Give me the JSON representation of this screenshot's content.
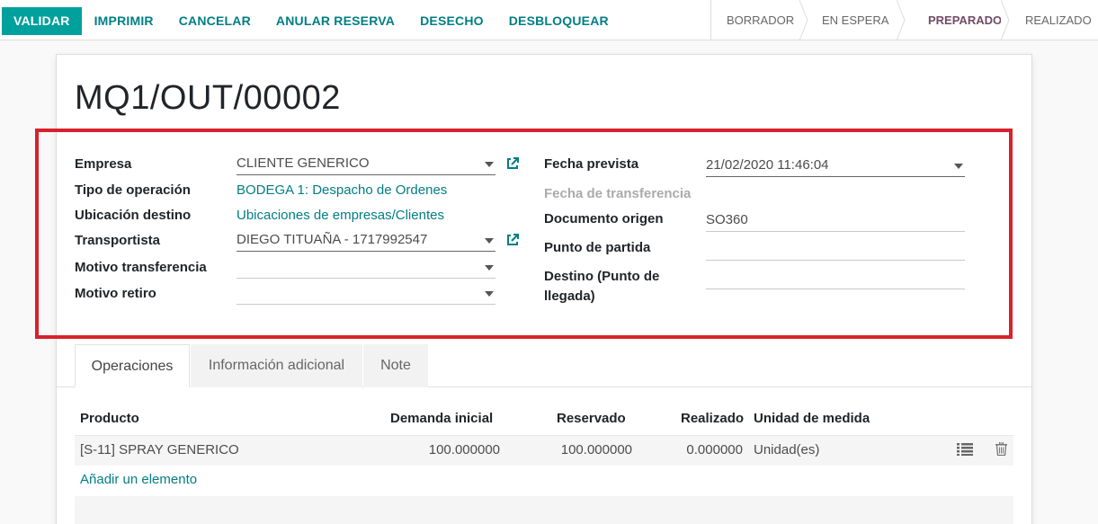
{
  "controlbar": {
    "actions": [
      "VALIDAR",
      "IMPRIMIR",
      "CANCELAR",
      "ANULAR RESERVA",
      "DESECHO",
      "DESBLOQUEAR"
    ],
    "stages": [
      "BORRADOR",
      "EN ESPERA",
      "PREPARADO",
      "REALIZADO"
    ],
    "active_stage": "PREPARADO"
  },
  "record": {
    "title": "MQ1/OUT/00002"
  },
  "left_fields": {
    "empresa": {
      "label": "Empresa",
      "value": "CLIENTE GENERICO"
    },
    "tipo_operacion": {
      "label": "Tipo de operación",
      "value": "BODEGA 1: Despacho de Ordenes"
    },
    "ubicacion_destino": {
      "label": "Ubicación destino",
      "value": "Ubicaciones de empresas/Clientes"
    },
    "transportista": {
      "label": "Transportista",
      "value": "DIEGO TITUAÑA - 1717992547"
    },
    "motivo_transferencia": {
      "label": "Motivo transferencia",
      "value": ""
    },
    "motivo_retiro": {
      "label": "Motivo retiro",
      "value": ""
    }
  },
  "right_fields": {
    "fecha_prevista": {
      "label": "Fecha prevista",
      "value": "21/02/2020 11:46:04"
    },
    "fecha_transferencia": {
      "label": "Fecha de transferencia",
      "value": ""
    },
    "documento_origen": {
      "label": "Documento origen",
      "value": "SO360"
    },
    "punto_partida": {
      "label": "Punto de partida",
      "value": ""
    },
    "destino_line1": "Destino (Punto de",
    "destino_line2": "llegada)",
    "destino_value": ""
  },
  "tabs": [
    "Operaciones",
    "Información adicional",
    "Note"
  ],
  "table": {
    "headers": [
      "Producto",
      "Demanda inicial",
      "Reservado",
      "Realizado",
      "Unidad de medida"
    ],
    "rows": [
      {
        "producto": "[S-11] SPRAY GENERICO",
        "demanda": "100.000000",
        "reservado": "100.000000",
        "realizado": "0.000000",
        "unidad": "Unidad(es)"
      }
    ],
    "add_line": "Añadir un elemento"
  },
  "icons": {
    "external_link": "external-link-icon",
    "detail": "list-detail-icon",
    "delete": "trash-icon"
  },
  "colors": {
    "primary": "#00a09d",
    "link": "#017e84",
    "active_stage": "#714b67",
    "highlight": "#d7212c"
  }
}
